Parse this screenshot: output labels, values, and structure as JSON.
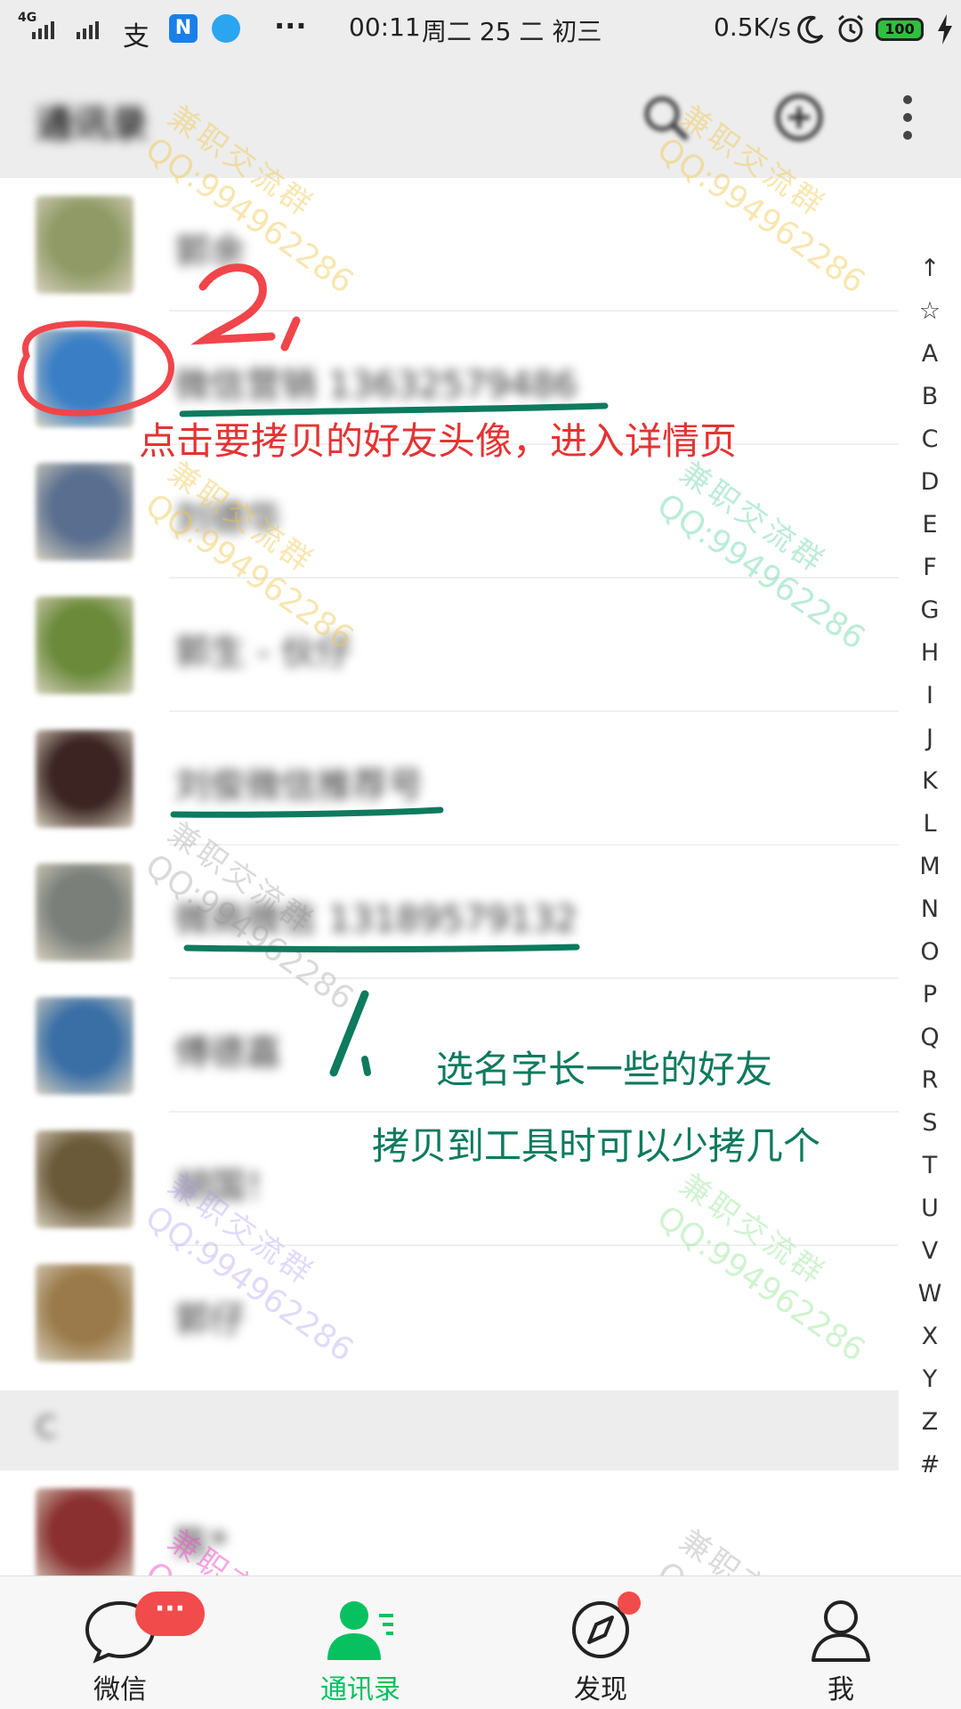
{
  "status_bar": {
    "network": "4G",
    "app_icon_zhi": "支",
    "app_icon_n": "N",
    "more": "···",
    "time": "00:11",
    "date": "周二 25 二 初三",
    "speed": "0.5K/s",
    "battery": "100"
  },
  "header": {
    "title": "通讯录"
  },
  "contacts": [
    {
      "name": "郭余",
      "avatar_color": "#8f9a66"
    },
    {
      "name": "微信营销 13632579486",
      "avatar_color": "#3a7fc6"
    },
    {
      "name": "刘德华",
      "avatar_color": "#5a6f8f"
    },
    {
      "name": "郭生 - 伙仔",
      "avatar_color": "#6b8a3a"
    },
    {
      "name": "刘俊微信推荐号",
      "avatar_color": "#3b2422"
    },
    {
      "name": "微商微信 13189579132",
      "avatar_color": "#7a7f7a"
    },
    {
      "name": "傅德嘉",
      "avatar_color": "#3a6fa6"
    },
    {
      "name": "胡国！",
      "avatar_color": "#6b5a3a"
    },
    {
      "name": "郭仔",
      "avatar_color": "#9a7a4a"
    }
  ],
  "section_header": "C",
  "last_contact": {
    "name": "陈*",
    "avatar_color": "#8a3030"
  },
  "index_letters": [
    "↑",
    "☆",
    "A",
    "B",
    "C",
    "D",
    "E",
    "F",
    "G",
    "H",
    "I",
    "J",
    "K",
    "L",
    "M",
    "N",
    "O",
    "P",
    "Q",
    "R",
    "S",
    "T",
    "U",
    "V",
    "W",
    "X",
    "Y",
    "Z",
    "#"
  ],
  "watermark": {
    "line1": "兼职交流群",
    "line2": "QQ:994962286"
  },
  "annotations": {
    "step2_number": "2,",
    "step2_text": "点击要拷贝的好友头像，进入详情页",
    "step1_number": "1.",
    "step1_line1": "选名字长一些的好友",
    "step1_line2": "拷贝到工具时可以少拷几个",
    "red_color": "#e53333",
    "green_color": "#0e7a5e"
  },
  "tabs": [
    {
      "label": "微信",
      "icon": "chat-bubble-icon"
    },
    {
      "label": "通讯录",
      "icon": "contacts-icon"
    },
    {
      "label": "发现",
      "icon": "compass-icon"
    },
    {
      "label": "我",
      "icon": "person-icon"
    }
  ],
  "badges": {
    "chats": "···"
  },
  "colors": {
    "accent": "#07c160",
    "badge": "#f24b4b"
  }
}
